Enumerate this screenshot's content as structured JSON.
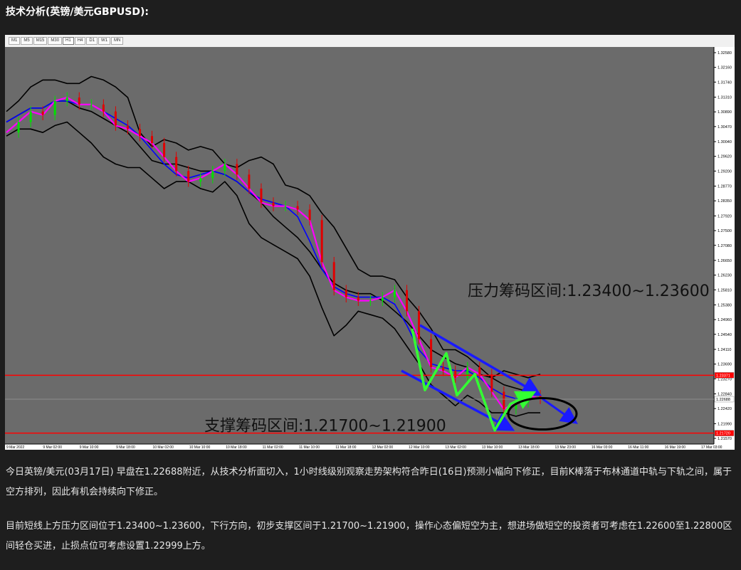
{
  "heading": "技术分析(英镑/美元GBPUSD):",
  "timeframes": [
    "M1",
    "M5",
    "M15",
    "M30",
    "H1",
    "H4",
    "D1",
    "W1",
    "MN"
  ],
  "active_timeframe": "H1",
  "paragraph1": "今日英镑/美元(03月17日) 早盘在1.22688附近，从技术分析面切入，1小时线级别观察走势架构符合昨日(16日)预测小幅向下修正，目前K棒落于布林通道中轨与下轨之间，属于空方排列，因此有机会持续向下修正。",
  "paragraph2": "目前短线上方压力区间位于1.23400~1.23600，下行方向，初步支撑区间于1.21700~1.21900，操作心态偏短空为主，想进场做短空的投资者可考虑在1.22600至1.22800区间轻仓买进，止损点位可考虑设置1.22999上方。",
  "chart_data": {
    "type": "line",
    "instrument": "GBPUSD",
    "price_axis_labels": [
      "1.32580",
      "1.32160",
      "1.31740",
      "1.31310",
      "1.30890",
      "1.30470",
      "1.30040",
      "1.29620",
      "1.29200",
      "1.28770",
      "1.28350",
      "1.27920",
      "1.27500",
      "1.27080",
      "1.26650",
      "1.26230",
      "1.25810",
      "1.25380",
      "1.24960",
      "1.24540",
      "1.24110",
      "1.23690",
      "1.23270",
      "1.22840",
      "1.22420",
      "1.21990",
      "1.21570"
    ],
    "ylim": [
      1.2157,
      1.3258
    ],
    "current_price": "1.22688",
    "resistance_line_label": "1.23371",
    "support_line_label": "1.21720",
    "time_labels": [
      "9 Mar 2022",
      "9 Mar 02:00",
      "9 Mar 10:00",
      "9 Mar 18:00",
      "10 Mar 02:00",
      "10 Mar 10:00",
      "10 Mar 18:00",
      "11 Mar 02:00",
      "11 Mar 10:00",
      "11 Mar 18:00",
      "12 Mar 02:00",
      "12 Mar 10:00",
      "13 Mar 02:00",
      "13 Mar 10:00",
      "13 Mar 18:00",
      "13 Mar 23:00",
      "16 Mar 03:00",
      "16 Mar 11:00",
      "16 Mar 19:00",
      "17 Mar 03:00"
    ],
    "annotations": {
      "resistance": "压力筹码区间:1.23400~1.23600",
      "support": "支撑筹码区间:1.21700~1.21900"
    },
    "colors": {
      "background": "#6b6b6b",
      "bull_candle": "#00e000",
      "bear_candle": "#e00000",
      "bollinger": "#000000",
      "ma_fast": "#ff00ff",
      "ma_slow": "#0000ff",
      "level_line": "#ff0000",
      "channel_arrow": "#1a1aff",
      "wave_arrow": "#33ff33"
    },
    "series": [
      {
        "values": [
          1.303,
          1.306,
          1.309,
          1.308,
          1.312,
          1.313,
          1.311,
          1.311,
          1.309,
          1.305,
          1.304,
          1.302,
          1.3,
          1.296,
          1.292,
          1.289,
          1.29,
          1.292,
          1.294,
          1.291,
          1.287,
          1.283,
          1.282,
          1.282,
          1.281,
          1.278,
          1.266,
          1.258,
          1.256,
          1.255,
          1.255,
          1.256,
          1.258,
          1.252,
          1.244,
          1.236,
          1.235,
          1.233,
          1.236,
          1.234,
          1.229,
          1.224,
          1.226,
          1.228,
          1.227
        ]
      },
      {
        "values": [
          1.306,
          1.308,
          1.31,
          1.31,
          1.312,
          1.312,
          1.311,
          1.311,
          1.309,
          1.307,
          1.305,
          1.302,
          1.298,
          1.294,
          1.291,
          1.29,
          1.291,
          1.292,
          1.291,
          1.289,
          1.286,
          1.284,
          1.283,
          1.282,
          1.279,
          1.272,
          1.264,
          1.259,
          1.257,
          1.256,
          1.256,
          1.256,
          1.254,
          1.248,
          1.241,
          1.237,
          1.236,
          1.235,
          1.235,
          1.233,
          1.23,
          1.228,
          1.227,
          1.227,
          1.227
        ]
      },
      {
        "values": [
          1.309,
          1.312,
          1.316,
          1.318,
          1.318,
          1.317,
          1.317,
          1.319,
          1.318,
          1.316,
          1.313,
          1.303,
          1.299,
          1.301,
          1.3,
          1.298,
          1.299,
          1.298,
          1.294,
          1.293,
          1.295,
          1.296,
          1.294,
          1.288,
          1.287,
          1.285,
          1.28,
          1.276,
          1.27,
          1.264,
          1.262,
          1.262,
          1.261,
          1.256,
          1.252,
          1.247,
          1.241,
          1.241,
          1.239,
          1.236,
          1.233,
          1.235,
          1.234,
          1.233,
          1.234
        ]
      },
      {
        "values": [
          1.306,
          1.308,
          1.31,
          1.31,
          1.312,
          1.312,
          1.31,
          1.309,
          1.307,
          1.305,
          1.303,
          1.299,
          1.295,
          1.294,
          1.294,
          1.293,
          1.292,
          1.292,
          1.291,
          1.289,
          1.286,
          1.283,
          1.279,
          1.276,
          1.273,
          1.269,
          1.264,
          1.26,
          1.258,
          1.257,
          1.257,
          1.255,
          1.252,
          1.249,
          1.245,
          1.241,
          1.239,
          1.237,
          1.236,
          1.234,
          1.233,
          1.231,
          1.23,
          1.229,
          1.228
        ]
      },
      {
        "values": [
          1.302,
          1.304,
          1.304,
          1.303,
          1.305,
          1.306,
          1.303,
          1.3,
          1.296,
          1.294,
          1.293,
          1.293,
          1.29,
          1.287,
          1.289,
          1.289,
          1.287,
          1.286,
          1.289,
          1.285,
          1.277,
          1.273,
          1.271,
          1.269,
          1.267,
          1.262,
          1.253,
          1.245,
          1.248,
          1.252,
          1.251,
          1.25,
          1.247,
          1.242,
          1.237,
          1.231,
          1.228,
          1.225,
          1.228,
          1.226,
          1.223,
          1.223,
          1.222,
          1.223,
          1.223
        ]
      }
    ]
  }
}
